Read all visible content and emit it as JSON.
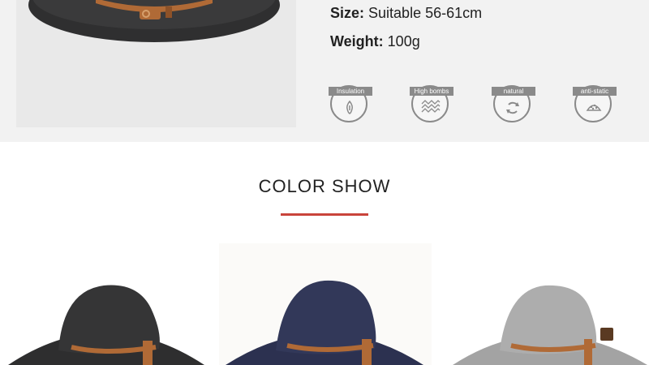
{
  "specs": {
    "size": {
      "label": "Size:",
      "value": "Suitable 56-61cm"
    },
    "weight": {
      "label": "Weight:",
      "value": "100g"
    }
  },
  "features": [
    {
      "label": "Insulation",
      "icon": "insulation-icon"
    },
    {
      "label": "High bombs",
      "icon": "high-bombs-icon"
    },
    {
      "label": "natural",
      "icon": "natural-icon"
    },
    {
      "label": "anti-static",
      "icon": "anti-static-icon"
    }
  ],
  "section": {
    "title": "COLOR SHOW"
  },
  "colors": {
    "accent": "#c9443b",
    "hero_hat": "#2f2f30",
    "black_hat": "#2e2e2f",
    "navy_hat": "#2c3150",
    "grey_hat": "#a3a3a3",
    "band": "#b06a36"
  }
}
